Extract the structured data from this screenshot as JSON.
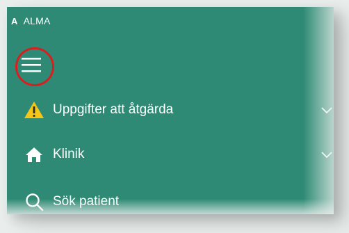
{
  "header": {
    "logo_letter": "A",
    "app_name": "ALMA"
  },
  "menu": {
    "toggle_icon": "hamburger-menu-icon",
    "highlight_color": "#d81f1f"
  },
  "nav": {
    "items": [
      {
        "label": "Uppgifter att åtgärda",
        "icon": "warning-icon",
        "expandable": true
      },
      {
        "label": "Klinik",
        "icon": "home-icon",
        "expandable": true
      },
      {
        "label": "Sök patient",
        "icon": "search-icon",
        "expandable": false
      }
    ]
  },
  "colors": {
    "panel_bg": "#2e8a74",
    "warning": "#f5c518",
    "text": "#ffffff"
  }
}
